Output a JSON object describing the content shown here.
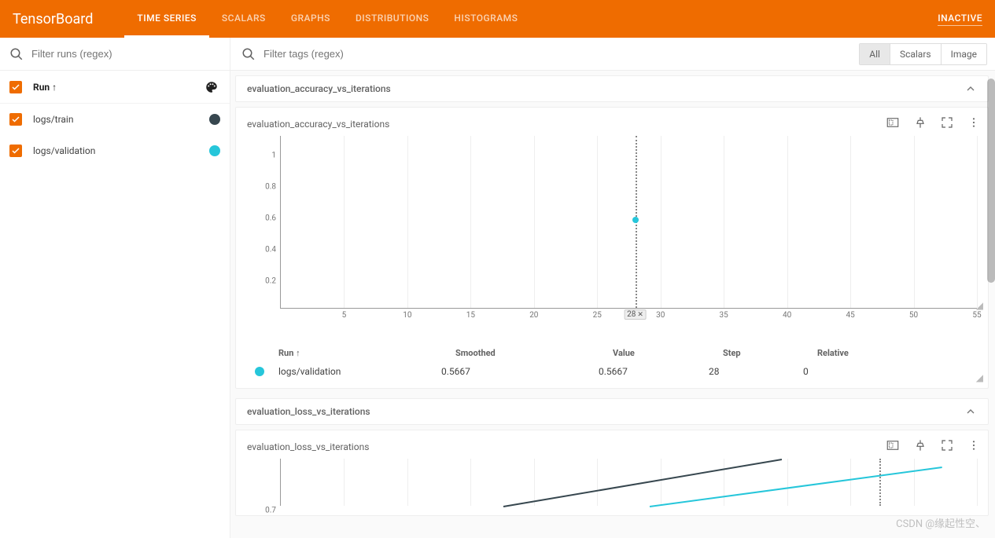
{
  "header": {
    "logo": "TensorBoard",
    "tabs": [
      "TIME SERIES",
      "SCALARS",
      "GRAPHS",
      "DISTRIBUTIONS",
      "HISTOGRAMS"
    ],
    "active_tab": 0,
    "status": "INACTIVE"
  },
  "sidebar": {
    "filter_placeholder": "Filter runs (regex)",
    "header_label": "Run ↑",
    "runs": [
      {
        "name": "logs/train",
        "color": "#37474f"
      },
      {
        "name": "logs/validation",
        "color": "#26c6da"
      }
    ]
  },
  "main": {
    "filter_placeholder": "Filter tags (regex)",
    "pills": [
      "All",
      "Scalars",
      "Image"
    ],
    "active_pill": 0
  },
  "sections": [
    {
      "title": "evaluation_accuracy_vs_iterations"
    },
    {
      "title": "evaluation_loss_vs_iterations"
    }
  ],
  "card1": {
    "title": "evaluation_accuracy_vs_iterations",
    "cursor_label": "28",
    "legend_headers": {
      "run": "Run ↑",
      "smoothed": "Smoothed",
      "value": "Value",
      "step": "Step",
      "relative": "Relative"
    },
    "legend_row": {
      "run": "logs/validation",
      "smoothed": "0.5667",
      "value": "0.5667",
      "step": "28",
      "relative": "0"
    }
  },
  "card2": {
    "title": "evaluation_loss_vs_iterations",
    "ytick": "0.7"
  },
  "watermark": "CSDN @缘起性空、",
  "chart_data": {
    "type": "scatter",
    "title": "evaluation_accuracy_vs_iterations",
    "xlabel": "",
    "ylabel": "",
    "xlim": [
      0,
      55
    ],
    "ylim": [
      0,
      1.1
    ],
    "xticks": [
      5,
      10,
      15,
      20,
      25,
      30,
      35,
      40,
      45,
      50,
      55
    ],
    "yticks": [
      0.2,
      0.4,
      0.6,
      0.8,
      1
    ],
    "cursor_x": 28,
    "series": [
      {
        "name": "logs/validation",
        "color": "#26c6da",
        "x": [
          28
        ],
        "y": [
          0.5667
        ]
      }
    ]
  }
}
